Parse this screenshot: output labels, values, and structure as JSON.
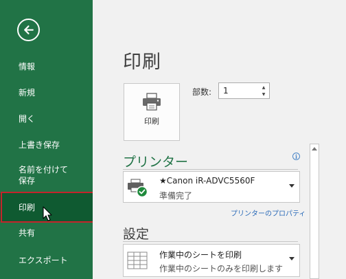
{
  "sidebar": {
    "items": [
      {
        "label": "情報"
      },
      {
        "label": "新規"
      },
      {
        "label": "開く"
      },
      {
        "label": "上書き保存"
      },
      {
        "label": "名前を付けて\n保存"
      },
      {
        "label": "印刷"
      },
      {
        "label": "共有"
      },
      {
        "label": "エクスポート"
      }
    ],
    "active_item": "印刷"
  },
  "main": {
    "title": "印刷",
    "print_button_label": "印刷",
    "copies_label": "部数:",
    "copies_value": "1",
    "printer": {
      "section_title": "プリンター",
      "name": "★Canon  iR-ADVC5560F",
      "status": "準備完了",
      "properties_link": "プリンターのプロパティ"
    },
    "settings": {
      "section_title": "設定",
      "option_main": "作業中のシートを印刷",
      "option_sub": "作業中のシートのみを印刷します"
    }
  },
  "colors": {
    "sidebar_bg": "#217346",
    "sidebar_active": "#0f5a31",
    "highlight_border": "#c5242b",
    "accent_text": "#217346",
    "link": "#2a6ab8"
  },
  "icons": [
    "back-arrow-icon",
    "printer-icon",
    "printer-ready-icon",
    "sheet-grid-icon",
    "info-icon"
  ]
}
